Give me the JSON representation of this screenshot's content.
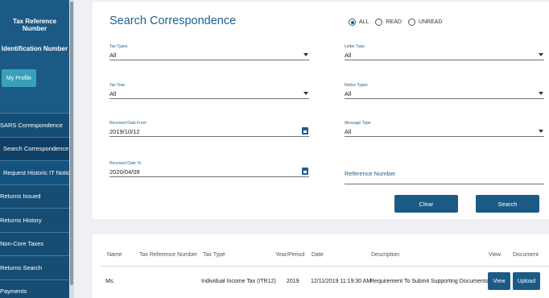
{
  "sidebar": {
    "tax_reference_label": "Tax Reference Number",
    "identification_label": "Identification Number",
    "profile_button": "My Profile",
    "nav": [
      {
        "label": "SARS Correspondence"
      },
      {
        "label": "Search Correspondence"
      },
      {
        "label": "Request Historic IT Notices"
      },
      {
        "label": "Returns Issued"
      },
      {
        "label": "Returns History"
      },
      {
        "label": "Non-Core Taxes"
      },
      {
        "label": "Returns Search"
      },
      {
        "label": "Payments"
      }
    ]
  },
  "search": {
    "title": "Search Correspondence",
    "filter": {
      "options": [
        "ALL",
        "READ",
        "UNREAD"
      ],
      "selected": "ALL"
    },
    "fields": {
      "tax_types": {
        "label": "Tax Types",
        "value": "All"
      },
      "letter_type": {
        "label": "Letter Type",
        "value": "All"
      },
      "tax_year": {
        "label": "Tax Year",
        "value": "All"
      },
      "notice_types": {
        "label": "Notice Types",
        "value": "All"
      },
      "received_from": {
        "label": "Received Date From",
        "value": "2019/10/12"
      },
      "message_type": {
        "label": "Message Type",
        "value": "All"
      },
      "received_to": {
        "label": "Received Date To",
        "value": "2020/04/09"
      },
      "reference_number": {
        "label": "Reference Number",
        "value": ""
      }
    },
    "clear_button": "Clear",
    "search_button": "Search"
  },
  "results": {
    "columns": [
      "Name",
      "Tax Reference Number",
      "Tax Type",
      "Year/Period",
      "Date",
      "Description",
      "View",
      "Document"
    ],
    "rows": [
      {
        "name": "Ms.",
        "tax_reference": "",
        "tax_type": "Individual Income Tax (ITR12)",
        "year": "2019",
        "date": "12/11/2019 11:19:30 AM",
        "description": "Requirement To Submit Supporting Documents",
        "view_button": "View",
        "upload_button": "Upload"
      }
    ]
  },
  "colors": {
    "primary": "#1c5a86",
    "accent": "#3aa0b8",
    "title": "#1f5f8b"
  }
}
